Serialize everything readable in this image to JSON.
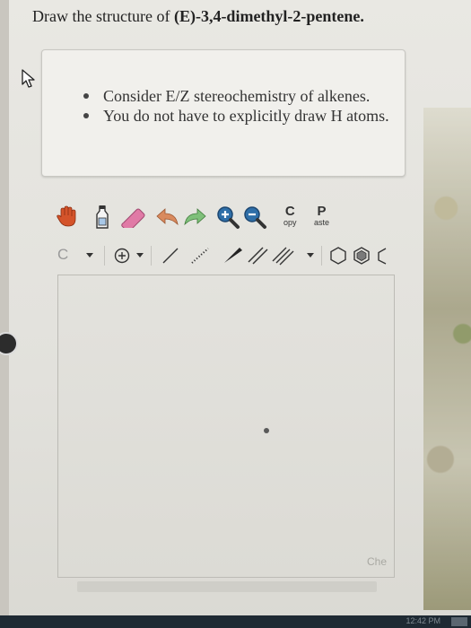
{
  "question": {
    "prefix": "Draw the structure of ",
    "compound": "(E)-3,4-dimethyl-2-pentene.",
    "hints": [
      "Consider E/Z stereochemistry of alkenes.",
      "You do not have to explicitly draw H atoms."
    ]
  },
  "toolbar": {
    "copy_big": "C",
    "copy_small": "opy",
    "paste_big": "P",
    "paste_small": "aste",
    "element_value": "C"
  },
  "editor": {
    "watermark": "Che"
  },
  "taskbar": {
    "clock": "12:42 PM"
  },
  "icons": {
    "hand": "hand-icon",
    "bottle": "bottle-icon",
    "eraser": "eraser-icon",
    "undo": "undo-icon",
    "redo": "redo-icon",
    "zoom_in": "zoom-in-icon",
    "zoom_out": "zoom-out-icon",
    "charge": "charge-plus-icon",
    "single_bond": "single-bond-icon",
    "hashed_bond": "hashed-bond-icon",
    "wedge_bond": "wedge-bond-icon",
    "double_bond": "double-bond-icon",
    "triple_bond": "triple-bond-icon",
    "cyclohexane": "cyclohexane-icon",
    "benzene": "benzene-icon",
    "chain": "chain-icon"
  },
  "colors": {
    "hand": "#d4532a",
    "eraser": "#e07aa6",
    "undo": "#d98a5e",
    "redo": "#7fc07a",
    "zoom": "#2f6fa8"
  }
}
